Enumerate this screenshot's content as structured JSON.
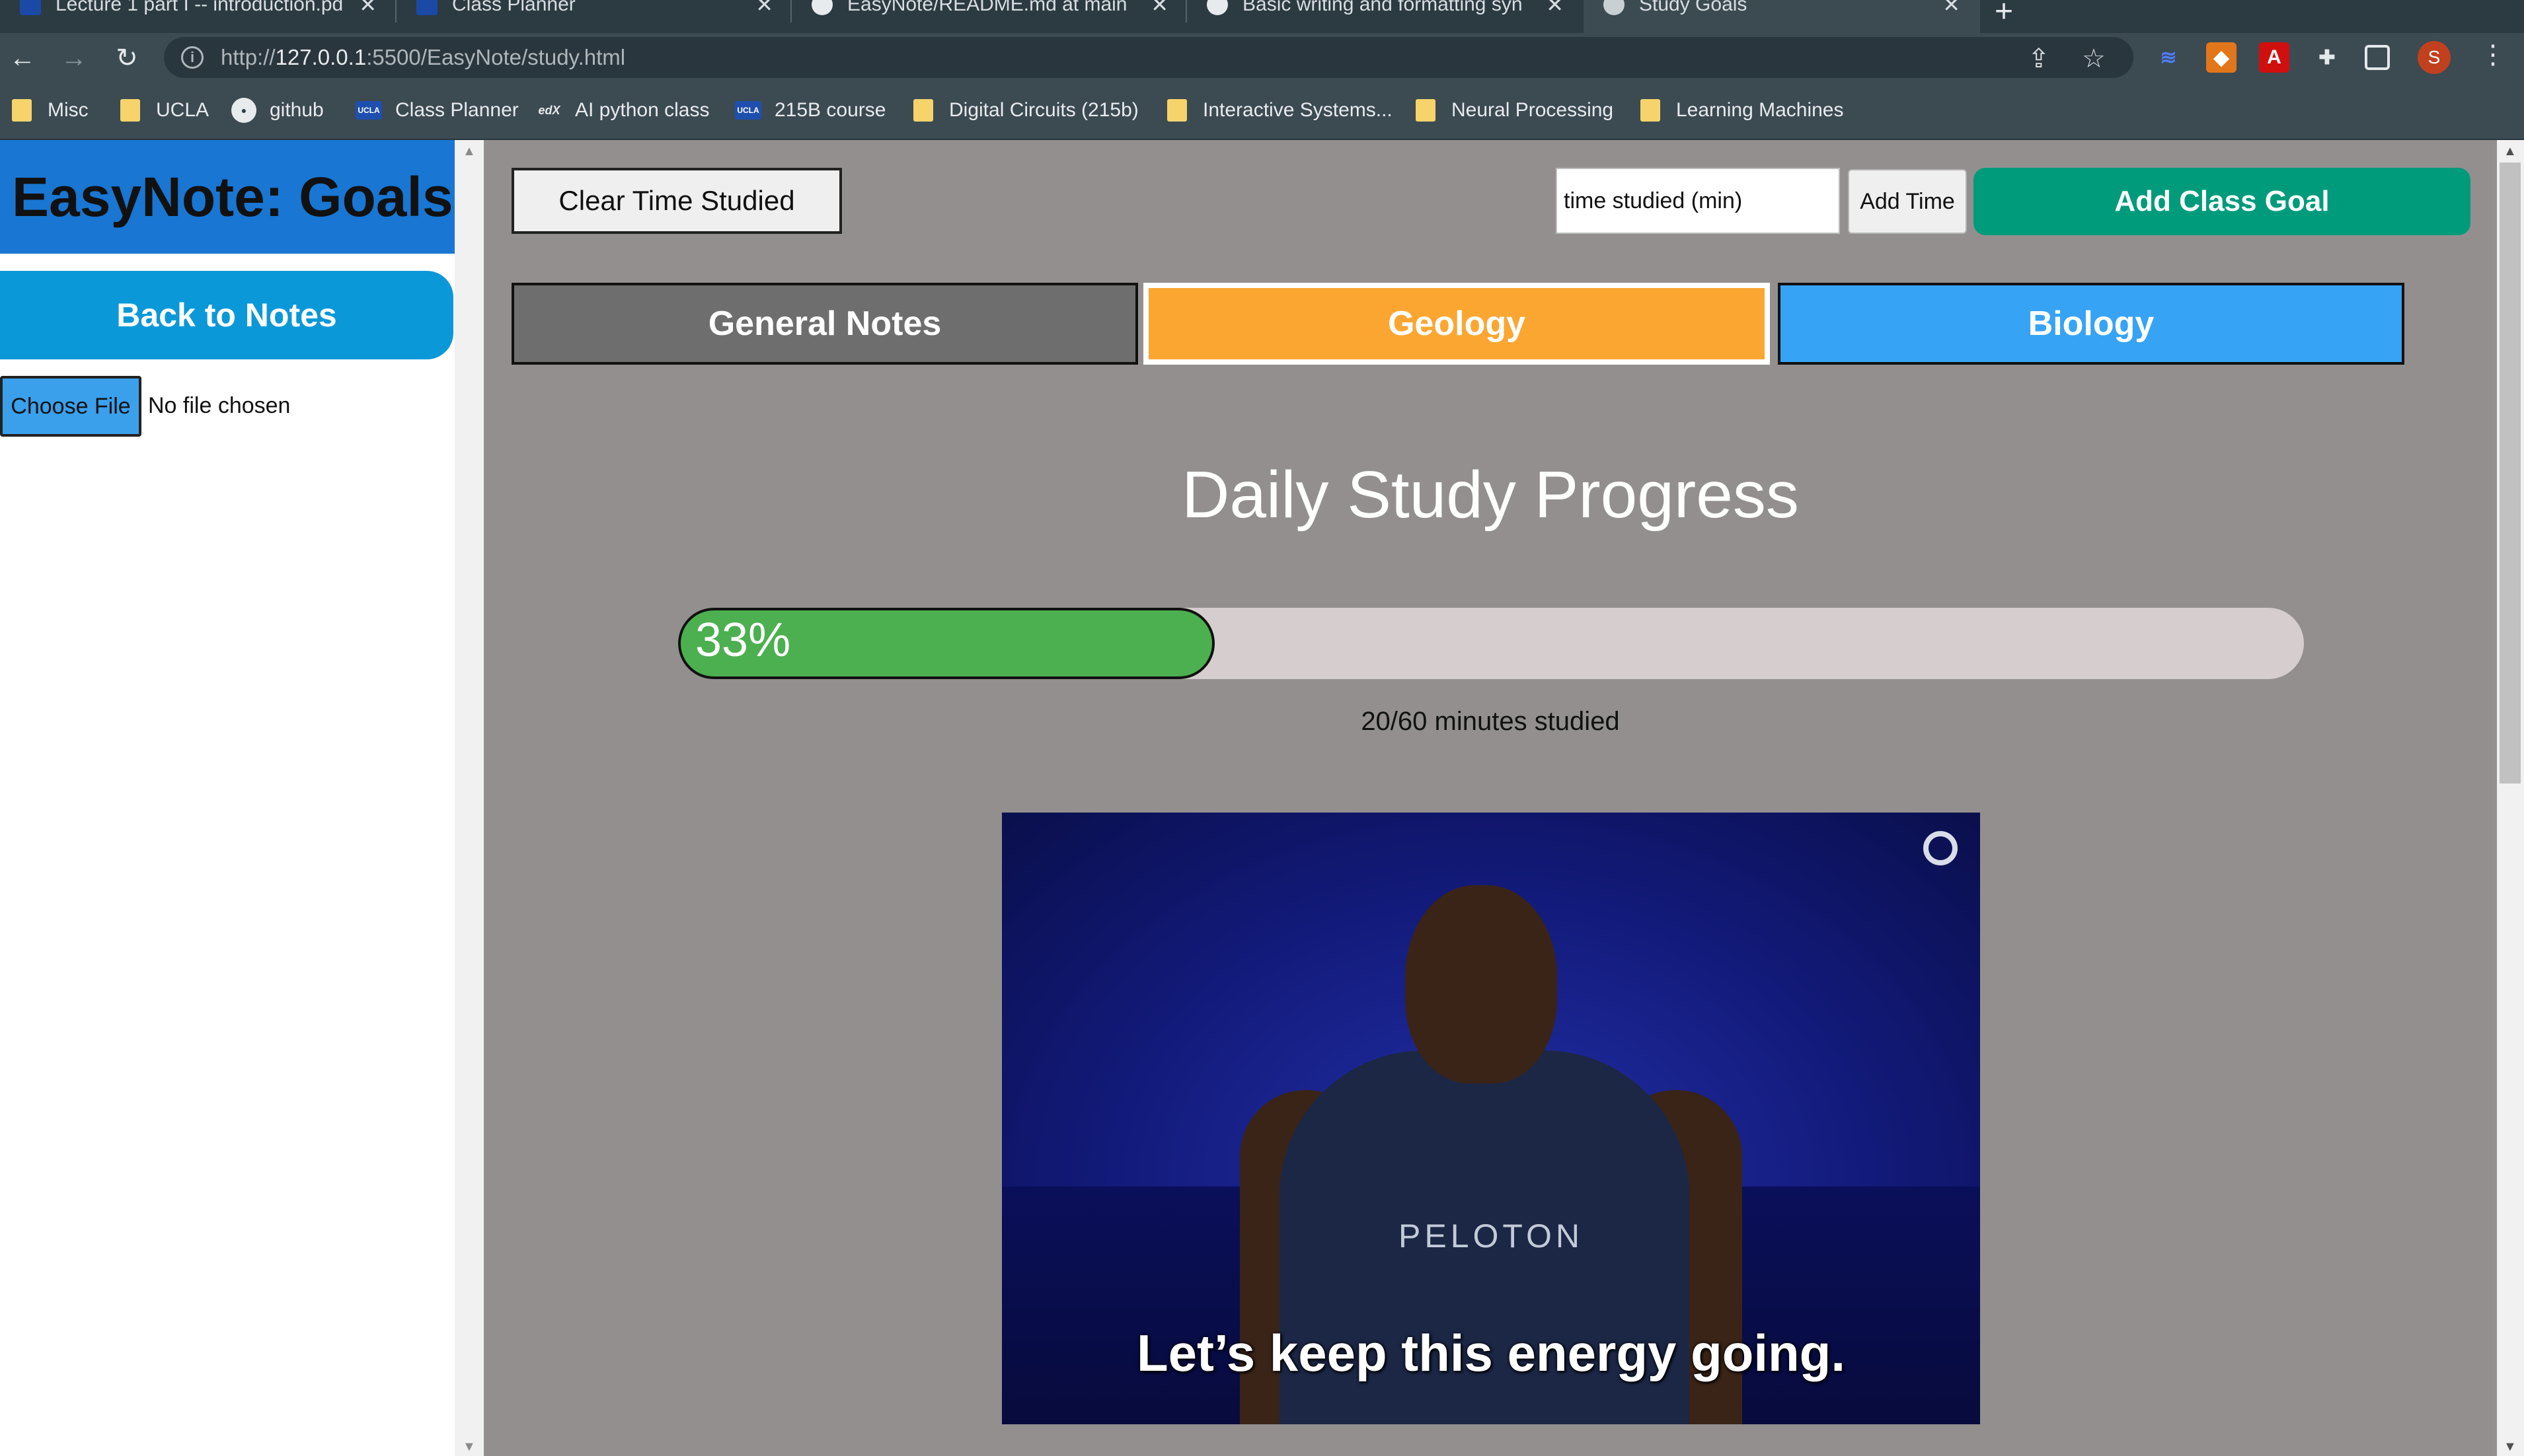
{
  "browser": {
    "tabs": [
      {
        "title": "Lecture 1 part I -- introduction.pd",
        "active": false
      },
      {
        "title": "Class Planner",
        "active": false
      },
      {
        "title": "EasyNote/README.md at main",
        "active": false
      },
      {
        "title": "Basic writing and formatting syn",
        "active": false
      },
      {
        "title": "Study Goals",
        "active": true
      }
    ],
    "new_tab_glyph": "+",
    "url": {
      "scheme": "http://",
      "host": "127.0.0.1",
      "rest": ":5500/EasyNote/study.html"
    },
    "profile_initial": "S",
    "bookmarks": [
      {
        "label": "Misc",
        "icon": "folder-icon"
      },
      {
        "label": "UCLA",
        "icon": "folder-icon"
      },
      {
        "label": "github",
        "icon": "github-icon"
      },
      {
        "label": "Class Planner",
        "icon": "ucla-icon"
      },
      {
        "label": "AI python class",
        "icon": "edx-icon"
      },
      {
        "label": "215B course",
        "icon": "ucla-icon"
      },
      {
        "label": "Digital Circuits (215b)",
        "icon": "folder-icon"
      },
      {
        "label": "Interactive Systems...",
        "icon": "folder-icon"
      },
      {
        "label": "Neural Processing",
        "icon": "folder-icon"
      },
      {
        "label": "Learning Machines",
        "icon": "folder-icon"
      }
    ]
  },
  "sidebar": {
    "title": "EasyNote: Goals",
    "back_button": "Back to Notes",
    "choose_file": "Choose File",
    "file_status": "No file chosen"
  },
  "toolbar": {
    "clear_button": "Clear Time Studied",
    "time_input_value": "time studied (min)",
    "add_time_button": "Add Time",
    "add_goal_button": "Add Class Goal"
  },
  "class_tabs": [
    {
      "label": "General Notes",
      "color": "#6e6e6e"
    },
    {
      "label": "Geology",
      "color": "#fca632"
    },
    {
      "label": "Biology",
      "color": "#36a3f5"
    }
  ],
  "progress": {
    "title": "Daily Study Progress",
    "percent_label": "33%",
    "fraction": 0.33,
    "caption": "20/60 minutes studied",
    "fill_color": "#4caf50"
  },
  "gif": {
    "caption": "Let’s keep this energy going.",
    "shirt_text": "PELOTON"
  },
  "colors": {
    "sidebar_header": "#1976d2",
    "back_button": "#0b98d8",
    "main_background": "#938f8f",
    "add_goal": "#009b7b"
  }
}
